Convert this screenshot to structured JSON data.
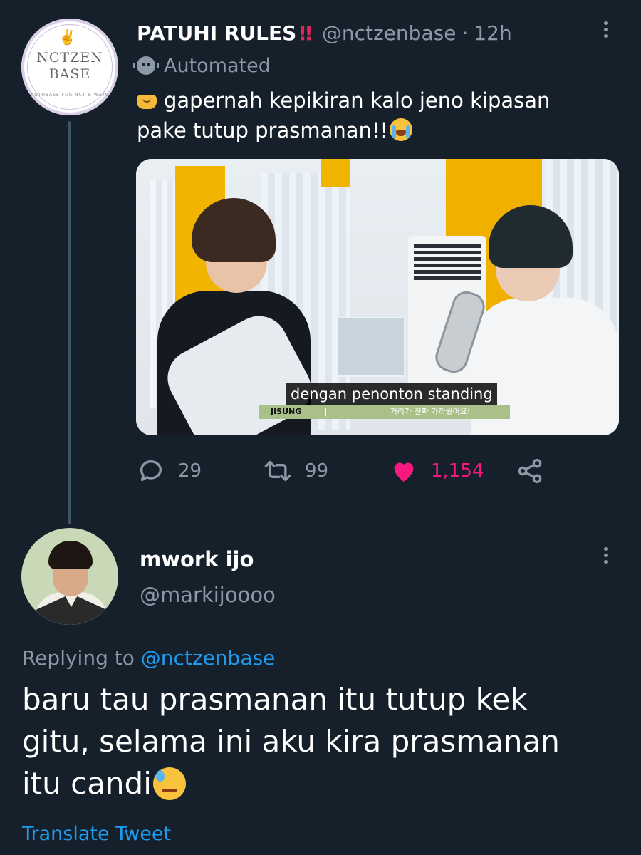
{
  "tweet1": {
    "avatar": {
      "line1": "NCTZEN",
      "line2": "BASE",
      "sub": "AUTOBASE FOR NCT & WAYV"
    },
    "display_name": "PATUHI RULES",
    "name_emoji": "‼",
    "handle": "@nctzenbase",
    "separator": "·",
    "time": "12h",
    "automated_label": "Automated",
    "text_line1": "gapernah kepikiran kalo jeno kipasan",
    "text_line2": "pake tutup prasmanan!!",
    "media": {
      "subtitle": "dengan penonton standing",
      "speaker": "JISUNG",
      "korean_caption": "거리가 진짜 가까웠어요!"
    },
    "stats": {
      "replies": "29",
      "retweets": "99",
      "likes": "1,154"
    }
  },
  "tweet2": {
    "display_name": "mwork ijo",
    "handle": "@markijoooo",
    "replying_prefix": "Replying to",
    "replying_to": "@nctzenbase",
    "text_line1": "baru tau prasmanan itu tutup kek",
    "text_line2": "gitu, selama ini aku kira prasmanan",
    "text_line3": "itu candi",
    "translate_label": "Translate Tweet"
  },
  "colors": {
    "background": "#15202b",
    "secondary_text": "#8b98a5",
    "link": "#1d9bf0",
    "like": "#f91880"
  }
}
